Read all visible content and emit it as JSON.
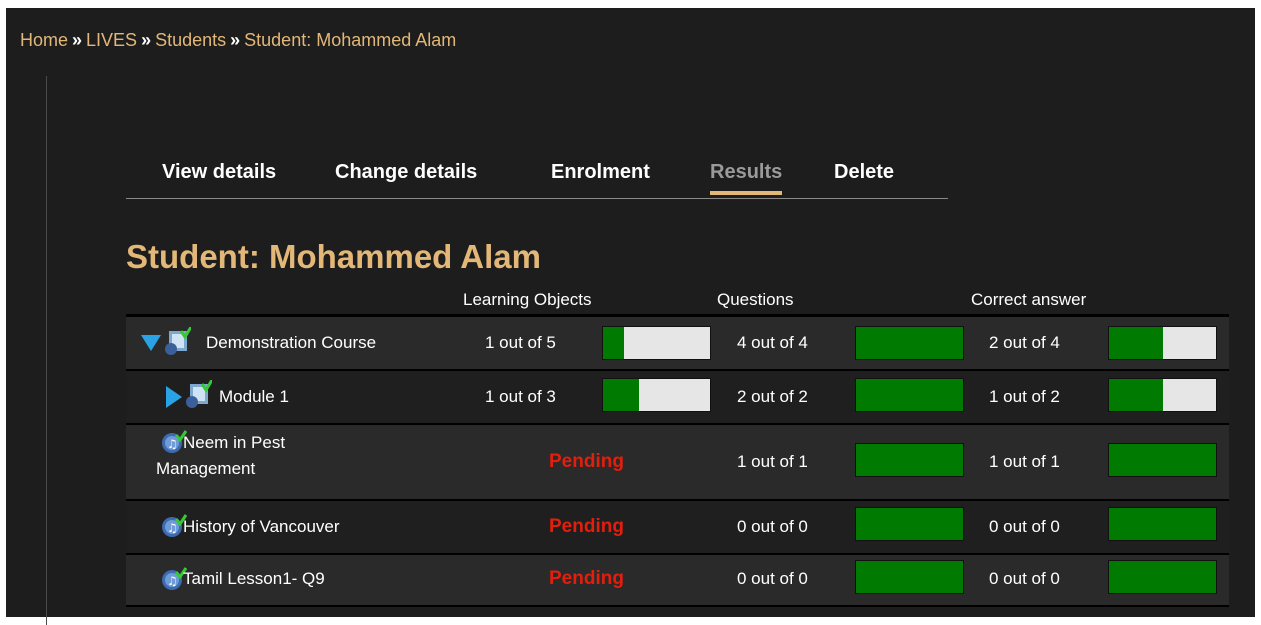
{
  "breadcrumb": {
    "home": "Home",
    "lives": "LIVES",
    "students": "Students",
    "current": "Student: Mohammed Alam",
    "separator": "»"
  },
  "tabs": [
    {
      "label": "View details",
      "active": false
    },
    {
      "label": "Change details",
      "active": false
    },
    {
      "label": "Enrolment",
      "active": false
    },
    {
      "label": "Results",
      "active": true
    },
    {
      "label": "Delete",
      "active": false
    }
  ],
  "page_title": "Student: Mohammed Alam",
  "columns": {
    "learning_objects": "Learning Objects",
    "questions": "Questions",
    "correct_answer": "Correct answer"
  },
  "colors": {
    "accent": "#e3b778",
    "pending": "#e31e0c",
    "bar_fill": "#007a00",
    "bar_empty": "#e6e6e6"
  },
  "rows": [
    {
      "name": "Demonstration Course",
      "icon": "course-package-icon",
      "expander": "expanded-triangle-icon",
      "learning_objects": {
        "text": "1 out of 5",
        "progress": 0.2
      },
      "questions": {
        "text": "4 out of 4",
        "progress": 1.0
      },
      "correct": {
        "text": "2 out of 4",
        "progress": 0.5
      }
    },
    {
      "name": "Module 1",
      "icon": "module-package-icon",
      "expander": "collapsed-triangle-icon",
      "learning_objects": {
        "text": "1 out of 3",
        "progress": 0.3333
      },
      "questions": {
        "text": "2 out of 2",
        "progress": 1.0
      },
      "correct": {
        "text": "1 out of 2",
        "progress": 0.5
      }
    },
    {
      "name": "Neem in Pest Management",
      "icon": "media-music-icon",
      "learning_objects": {
        "text": "Pending"
      },
      "questions": {
        "text": "1 out of 1",
        "progress": 1.0
      },
      "correct": {
        "text": "1 out of 1",
        "progress": 1.0
      }
    },
    {
      "name": "History of Vancouver",
      "icon": "media-music-icon",
      "learning_objects": {
        "text": "Pending"
      },
      "questions": {
        "text": "0 out of 0",
        "progress": 1.0
      },
      "correct": {
        "text": "0 out of 0",
        "progress": 1.0
      }
    },
    {
      "name": "Tamil Lesson1- Q9",
      "icon": "media-music-icon",
      "learning_objects": {
        "text": "Pending"
      },
      "questions": {
        "text": "0 out of 0",
        "progress": 1.0
      },
      "correct": {
        "text": "0 out of 0",
        "progress": 1.0
      }
    }
  ]
}
